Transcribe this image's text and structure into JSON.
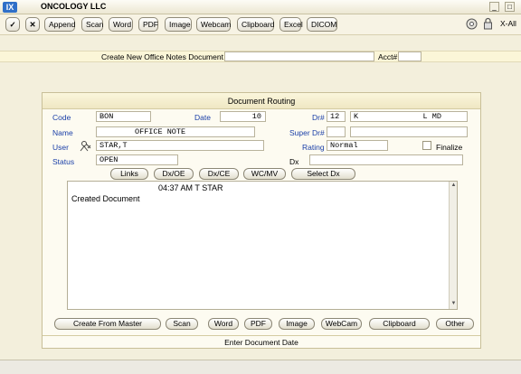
{
  "window": {
    "app_icon": "IX",
    "title": "ONCOLOGY LLC",
    "xall_label": "X-All"
  },
  "toolbar": {
    "buttons": [
      "Append",
      "Scan",
      "Word",
      "PDF",
      "Image",
      "Webcam",
      "Clipboard",
      "Excel",
      "DICOM"
    ]
  },
  "notes_bar": {
    "label": "Create New Office Notes Document",
    "acct_label": "Acct#",
    "acct_value": ""
  },
  "panel": {
    "title": "Document Routing",
    "code_label": "Code",
    "code_value": "BON",
    "date_label": "Date",
    "date_value": "10",
    "dr_label": "Dr#",
    "dr_value": "12",
    "dr_name": "K              L MD",
    "name_label": "Name",
    "name_value": "OFFICE NOTE",
    "superdr_label": "Super Dr#",
    "superdr_value": "",
    "superdr_name": "",
    "user_label": "User",
    "user_value": "STAR,T",
    "rating_label": "Rating",
    "rating_value": "Normal",
    "finalize_label": "Finalize",
    "status_label": "Status",
    "status_value": "OPEN",
    "dx_label": "Dx",
    "dx_value": "",
    "action_buttons": [
      "Links",
      "Dx/OE",
      "Dx/CE",
      "WC/MV",
      "Select Dx"
    ],
    "note_header": "04:37 AM  T STAR",
    "note_body": "Created Document",
    "bottom_buttons": [
      "Create From Master",
      "Scan",
      "Word",
      "PDF",
      "Image",
      "WebCam",
      "Clipboard",
      "Other"
    ],
    "status_text": "Enter Document Date"
  }
}
